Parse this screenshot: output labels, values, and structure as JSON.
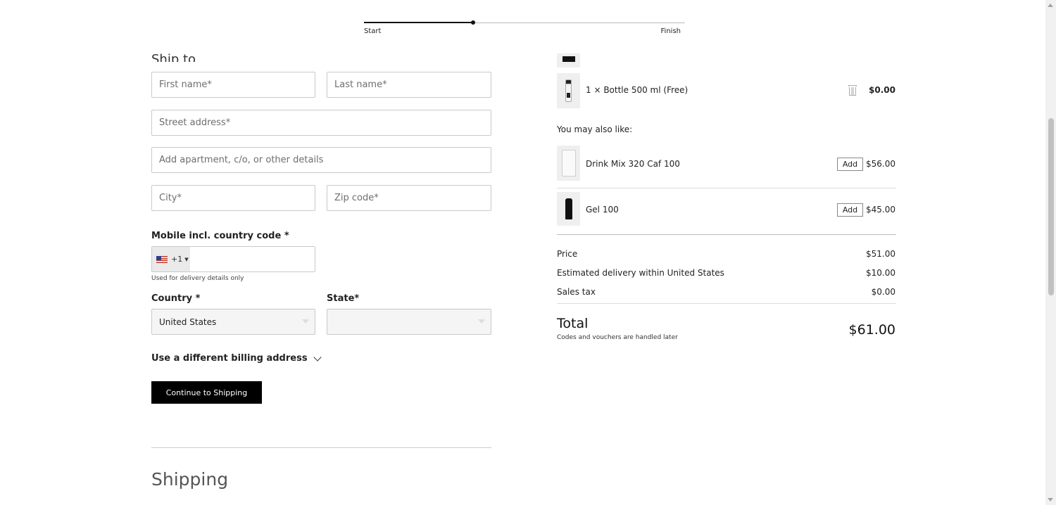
{
  "progress": {
    "start_label": "Start",
    "finish_label": "Finish",
    "fraction": 0.34
  },
  "form": {
    "section_heading": "Ship to",
    "first_name_placeholder": "First name*",
    "last_name_placeholder": "Last name*",
    "street_placeholder": "Street address*",
    "apartment_placeholder": "Add apartment, c/o, or other details",
    "city_placeholder": "City*",
    "zip_placeholder": "Zip code*",
    "mobile_label": "Mobile incl. country code *",
    "country_code": "+1",
    "mobile_note": "Used for delivery details only",
    "country_label": "Country *",
    "country_value": "United States",
    "state_label": "State*",
    "state_value": "",
    "billing_toggle": "Use a different billing address",
    "continue_button": "Continue to Shipping"
  },
  "next_section_heading": "Shipping",
  "cart": {
    "item": {
      "name": "1 × Bottle 500 ml (Free)",
      "price": "$0.00"
    },
    "may_like_heading": "You may also like:",
    "suggestions": [
      {
        "name": "Drink Mix 320 Caf 100",
        "add_label": "Add",
        "price": "$56.00"
      },
      {
        "name": "Gel 100",
        "add_label": "Add",
        "price": "$45.00"
      }
    ],
    "summary": [
      {
        "label": "Price",
        "value": "$51.00"
      },
      {
        "label": "Estimated delivery within United States",
        "value": "$10.00"
      },
      {
        "label": "Sales tax",
        "value": "$0.00"
      }
    ],
    "total_label": "Total",
    "total_value": "$61.00",
    "total_note": "Codes and vouchers are handled later"
  },
  "icons": {
    "trash": "trash-icon",
    "chevron": "chevron-down-icon",
    "flag": "us-flag-icon"
  }
}
